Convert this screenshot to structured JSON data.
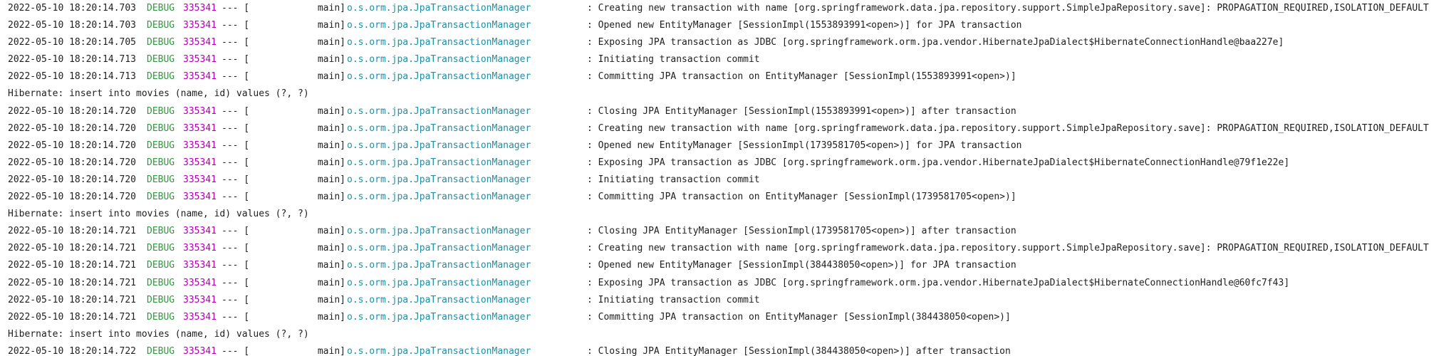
{
  "console": {
    "lines": [
      {
        "type": "log",
        "timestamp": "2022-05-10 18:20:14.703",
        "level": "DEBUG",
        "pid": "335341",
        "separator": "--- [",
        "thread": "main]",
        "logger": "o.s.orm.jpa.JpaTransactionManager",
        "message": ": Creating new transaction with name [org.springframework.data.jpa.repository.support.SimpleJpaRepository.save]: PROPAGATION_REQUIRED,ISOLATION_DEFAULT"
      },
      {
        "type": "log",
        "timestamp": "2022-05-10 18:20:14.703",
        "level": "DEBUG",
        "pid": "335341",
        "separator": "--- [",
        "thread": "main]",
        "logger": "o.s.orm.jpa.JpaTransactionManager",
        "message": ": Opened new EntityManager [SessionImpl(1553893991<open>)] for JPA transaction"
      },
      {
        "type": "log",
        "timestamp": "2022-05-10 18:20:14.705",
        "level": "DEBUG",
        "pid": "335341",
        "separator": "--- [",
        "thread": "main]",
        "logger": "o.s.orm.jpa.JpaTransactionManager",
        "message": ": Exposing JPA transaction as JDBC [org.springframework.orm.jpa.vendor.HibernateJpaDialect$HibernateConnectionHandle@baa227e]"
      },
      {
        "type": "log",
        "timestamp": "2022-05-10 18:20:14.713",
        "level": "DEBUG",
        "pid": "335341",
        "separator": "--- [",
        "thread": "main]",
        "logger": "o.s.orm.jpa.JpaTransactionManager",
        "message": ": Initiating transaction commit"
      },
      {
        "type": "log",
        "timestamp": "2022-05-10 18:20:14.713",
        "level": "DEBUG",
        "pid": "335341",
        "separator": "--- [",
        "thread": "main]",
        "logger": "o.s.orm.jpa.JpaTransactionManager",
        "message": ": Committing JPA transaction on EntityManager [SessionImpl(1553893991<open>)]"
      },
      {
        "type": "plain",
        "text": "Hibernate: insert into movies (name, id) values (?, ?)"
      },
      {
        "type": "log",
        "timestamp": "2022-05-10 18:20:14.720",
        "level": "DEBUG",
        "pid": "335341",
        "separator": "--- [",
        "thread": "main]",
        "logger": "o.s.orm.jpa.JpaTransactionManager",
        "message": ": Closing JPA EntityManager [SessionImpl(1553893991<open>)] after transaction"
      },
      {
        "type": "log",
        "timestamp": "2022-05-10 18:20:14.720",
        "level": "DEBUG",
        "pid": "335341",
        "separator": "--- [",
        "thread": "main]",
        "logger": "o.s.orm.jpa.JpaTransactionManager",
        "message": ": Creating new transaction with name [org.springframework.data.jpa.repository.support.SimpleJpaRepository.save]: PROPAGATION_REQUIRED,ISOLATION_DEFAULT"
      },
      {
        "type": "log",
        "timestamp": "2022-05-10 18:20:14.720",
        "level": "DEBUG",
        "pid": "335341",
        "separator": "--- [",
        "thread": "main]",
        "logger": "o.s.orm.jpa.JpaTransactionManager",
        "message": ": Opened new EntityManager [SessionImpl(1739581705<open>)] for JPA transaction"
      },
      {
        "type": "log",
        "timestamp": "2022-05-10 18:20:14.720",
        "level": "DEBUG",
        "pid": "335341",
        "separator": "--- [",
        "thread": "main]",
        "logger": "o.s.orm.jpa.JpaTransactionManager",
        "message": ": Exposing JPA transaction as JDBC [org.springframework.orm.jpa.vendor.HibernateJpaDialect$HibernateConnectionHandle@79f1e22e]"
      },
      {
        "type": "log",
        "timestamp": "2022-05-10 18:20:14.720",
        "level": "DEBUG",
        "pid": "335341",
        "separator": "--- [",
        "thread": "main]",
        "logger": "o.s.orm.jpa.JpaTransactionManager",
        "message": ": Initiating transaction commit"
      },
      {
        "type": "log",
        "timestamp": "2022-05-10 18:20:14.720",
        "level": "DEBUG",
        "pid": "335341",
        "separator": "--- [",
        "thread": "main]",
        "logger": "o.s.orm.jpa.JpaTransactionManager",
        "message": ": Committing JPA transaction on EntityManager [SessionImpl(1739581705<open>)]"
      },
      {
        "type": "plain",
        "text": "Hibernate: insert into movies (name, id) values (?, ?)"
      },
      {
        "type": "log",
        "timestamp": "2022-05-10 18:20:14.721",
        "level": "DEBUG",
        "pid": "335341",
        "separator": "--- [",
        "thread": "main]",
        "logger": "o.s.orm.jpa.JpaTransactionManager",
        "message": ": Closing JPA EntityManager [SessionImpl(1739581705<open>)] after transaction"
      },
      {
        "type": "log",
        "timestamp": "2022-05-10 18:20:14.721",
        "level": "DEBUG",
        "pid": "335341",
        "separator": "--- [",
        "thread": "main]",
        "logger": "o.s.orm.jpa.JpaTransactionManager",
        "message": ": Creating new transaction with name [org.springframework.data.jpa.repository.support.SimpleJpaRepository.save]: PROPAGATION_REQUIRED,ISOLATION_DEFAULT"
      },
      {
        "type": "log",
        "timestamp": "2022-05-10 18:20:14.721",
        "level": "DEBUG",
        "pid": "335341",
        "separator": "--- [",
        "thread": "main]",
        "logger": "o.s.orm.jpa.JpaTransactionManager",
        "message": ": Opened new EntityManager [SessionImpl(384438050<open>)] for JPA transaction"
      },
      {
        "type": "log",
        "timestamp": "2022-05-10 18:20:14.721",
        "level": "DEBUG",
        "pid": "335341",
        "separator": "--- [",
        "thread": "main]",
        "logger": "o.s.orm.jpa.JpaTransactionManager",
        "message": ": Exposing JPA transaction as JDBC [org.springframework.orm.jpa.vendor.HibernateJpaDialect$HibernateConnectionHandle@60fc7f43]"
      },
      {
        "type": "log",
        "timestamp": "2022-05-10 18:20:14.721",
        "level": "DEBUG",
        "pid": "335341",
        "separator": "--- [",
        "thread": "main]",
        "logger": "o.s.orm.jpa.JpaTransactionManager",
        "message": ": Initiating transaction commit"
      },
      {
        "type": "log",
        "timestamp": "2022-05-10 18:20:14.721",
        "level": "DEBUG",
        "pid": "335341",
        "separator": "--- [",
        "thread": "main]",
        "logger": "o.s.orm.jpa.JpaTransactionManager",
        "message": ": Committing JPA transaction on EntityManager [SessionImpl(384438050<open>)]"
      },
      {
        "type": "plain",
        "text": "Hibernate: insert into movies (name, id) values (?, ?)"
      },
      {
        "type": "log",
        "timestamp": "2022-05-10 18:20:14.722",
        "level": "DEBUG",
        "pid": "335341",
        "separator": "--- [",
        "thread": "main]",
        "logger": "o.s.orm.jpa.JpaTransactionManager",
        "message": ": Closing JPA EntityManager [SessionImpl(384438050<open>)] after transaction"
      }
    ]
  },
  "colors": {
    "background": "#ffffff",
    "text": "#1f1f1f",
    "level_debug": "#2d9b3c",
    "pid": "#b300b3",
    "logger": "#1f8fa6"
  }
}
